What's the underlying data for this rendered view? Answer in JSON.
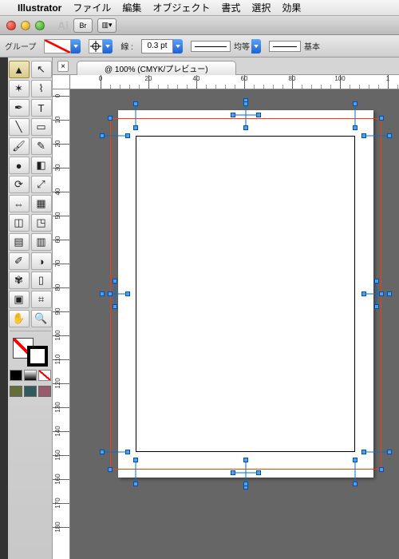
{
  "menubar": {
    "apple_icon": "apple-logo",
    "app": "Illustrator",
    "items": [
      "ファイル",
      "編集",
      "オブジェクト",
      "書式",
      "選択",
      "効果"
    ]
  },
  "titlebar": {
    "ai_label": "Ai",
    "br_label": "Br"
  },
  "control": {
    "selection_label": "グループ",
    "stroke_label": "線 :",
    "stroke_value": "0.3 pt",
    "uniform_label": "均等",
    "basic_label": "基本"
  },
  "tab": {
    "title": "@ 100% (CMYK/プレビュー)"
  },
  "ruler_h_labels": [
    "0",
    "20",
    "40",
    "60",
    "80",
    "100",
    "1"
  ],
  "ruler_v_labels": [
    "0",
    "10",
    "20",
    "30",
    "40",
    "50",
    "60",
    "70",
    "80",
    "90",
    "100",
    "110",
    "120",
    "130",
    "140",
    "150",
    "160",
    "170",
    "180"
  ],
  "tools": {
    "row_icons": [
      [
        "selection",
        "direct-selection"
      ],
      [
        "magic-wand",
        "lasso"
      ],
      [
        "pen",
        "type"
      ],
      [
        "line",
        "rectangle"
      ],
      [
        "paintbrush",
        "pencil"
      ],
      [
        "blob-brush",
        "eraser"
      ],
      [
        "rotate",
        "scale"
      ],
      [
        "width",
        "free-transform"
      ],
      [
        "shape-builder",
        "perspective"
      ],
      [
        "mesh",
        "gradient"
      ],
      [
        "eyedropper",
        "blend"
      ],
      [
        "symbol-sprayer",
        "graph"
      ],
      [
        "artboard",
        "slice"
      ],
      [
        "hand",
        "zoom"
      ]
    ],
    "glyphs": [
      [
        "▲",
        "↖"
      ],
      [
        "✶",
        "⌇"
      ],
      [
        "✒",
        "T"
      ],
      [
        "╲",
        "▭"
      ],
      [
        "🖌",
        "✎"
      ],
      [
        "●",
        "◧"
      ],
      [
        "⟳",
        "⤢"
      ],
      [
        "⇔",
        "▦"
      ],
      [
        "◫",
        "◳"
      ],
      [
        "▤",
        "▥"
      ],
      [
        "✐",
        "◑"
      ],
      [
        "✾",
        "▯"
      ],
      [
        "▣",
        "⌗"
      ],
      [
        "✋",
        "🔍"
      ]
    ]
  },
  "colors": {
    "swatch1": "#646e3a",
    "swatch2": "#2f5a5e",
    "swatch3": "#985a6d"
  }
}
